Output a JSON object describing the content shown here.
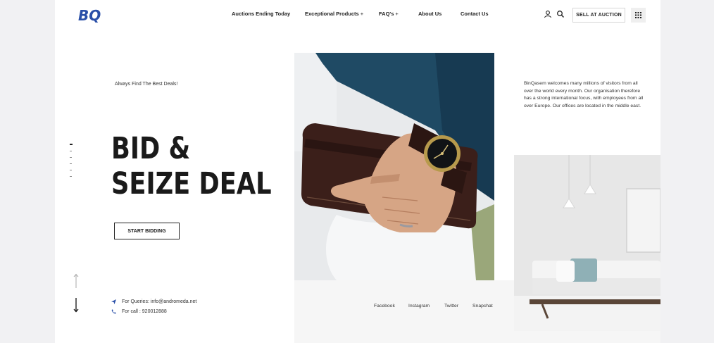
{
  "header": {
    "logo_text": "BQ",
    "nav": [
      {
        "label": "Auctions Ending Today",
        "has_dropdown": false
      },
      {
        "label": "Exceptional Products",
        "has_dropdown": true
      },
      {
        "label": "FAQ's",
        "has_dropdown": true
      },
      {
        "label": "About Us",
        "has_dropdown": false
      },
      {
        "label": "Contact Us",
        "has_dropdown": false
      }
    ],
    "dropdown_marker": "+",
    "icons": [
      "user-icon",
      "search-icon",
      "grid-menu-icon"
    ],
    "sell_button": "SELL AT AUCTION"
  },
  "hero": {
    "tagline": "Always Find The Best Deals!",
    "headline_line1": "BID &",
    "headline_line2": "SEIZE DEAL",
    "cta": "START BIDDING",
    "slider_dots": 6,
    "active_dot": 0
  },
  "about_text": "BinQasem welcomes many millions of visitors from all over the world every month. Our organisation therefore has a strong international focus, with employees from all over Europe. Our offices are located in the middle east.",
  "contact": {
    "queries": "For Queries: info@andromeda.net",
    "call": "For call : 920012888"
  },
  "social": [
    "Facebook",
    "Instagram",
    "Twitter",
    "Snapchat"
  ],
  "colors": {
    "brand": "#2a4fa8",
    "text": "#1a1a1a",
    "background": "#f1f1f3",
    "shirt": "#1f4a64"
  }
}
